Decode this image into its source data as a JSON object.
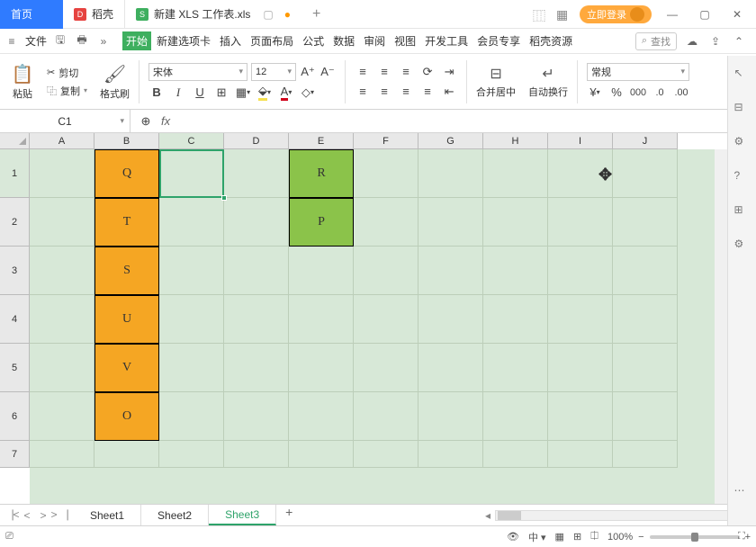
{
  "titlebar": {
    "home": "首页",
    "dk": "稻壳",
    "doc": "新建 XLS 工作表.xls",
    "plus": "+",
    "login": "立即登录"
  },
  "menubar": {
    "file": "文件",
    "tabs": [
      "开始",
      "新建选项卡",
      "插入",
      "页面布局",
      "公式",
      "数据",
      "审阅",
      "视图",
      "开发工具",
      "会员专享",
      "稻壳资源"
    ],
    "search": "查找"
  },
  "ribbon": {
    "paste": "粘贴",
    "cut": "剪切",
    "copy": "复制",
    "format_painter": "格式刷",
    "font_name": "宋体",
    "font_size": "12",
    "merge": "合并居中",
    "wrap": "自动换行",
    "number_format": "常规"
  },
  "namebox": "C1",
  "columns": [
    "A",
    "B",
    "C",
    "D",
    "E",
    "F",
    "G",
    "H",
    "I",
    "J"
  ],
  "rows": [
    "1",
    "2",
    "3",
    "4",
    "5",
    "6",
    "7"
  ],
  "cells": {
    "B1": "Q",
    "B2": "T",
    "B3": "S",
    "B4": "U",
    "B5": "V",
    "B6": "O",
    "E1": "R",
    "E2": "P"
  },
  "sheets": [
    "Sheet1",
    "Sheet2",
    "Sheet3"
  ],
  "active_sheet": 2,
  "status": {
    "zoom": "100%"
  },
  "chart_data": {
    "type": "table",
    "title": "",
    "columns": [
      "A",
      "B",
      "C",
      "D",
      "E",
      "F",
      "G",
      "H",
      "I",
      "J"
    ],
    "rows": [
      {
        "B": "Q",
        "E": "R"
      },
      {
        "B": "T",
        "E": "P"
      },
      {
        "B": "S"
      },
      {
        "B": "U"
      },
      {
        "B": "V"
      },
      {
        "B": "O"
      },
      {}
    ],
    "selected_cell": "C1",
    "highlight": {
      "B1:B6": "#f5a623",
      "E1:E2": "#8bc34a"
    }
  }
}
